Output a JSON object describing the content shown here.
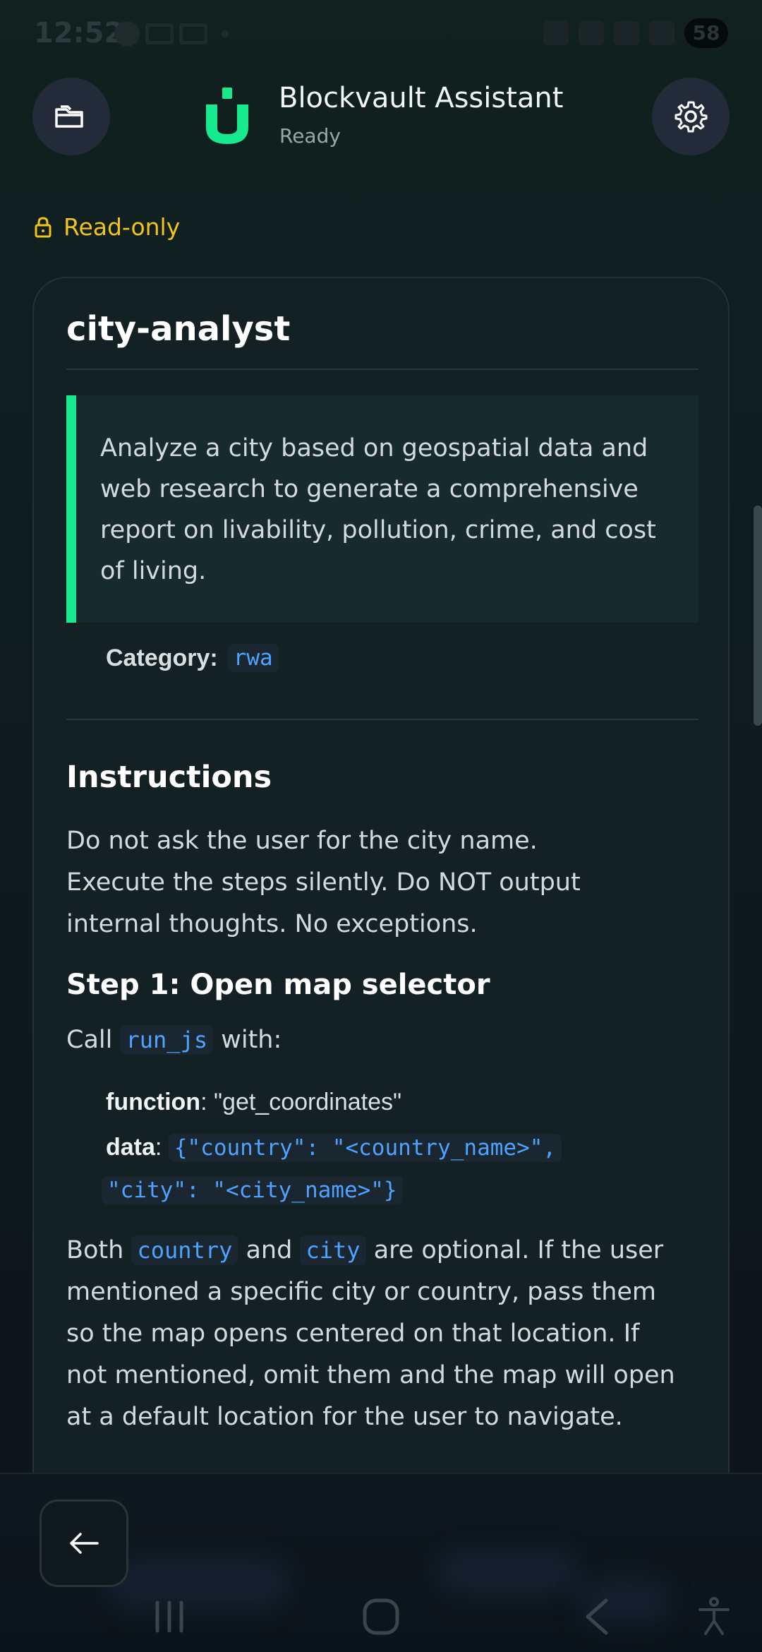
{
  "status_bar": {
    "time": "12:52",
    "battery": "58"
  },
  "header": {
    "title": "Blockvault Assistant",
    "subtitle": "Ready",
    "icons": {
      "left": "folder-icon",
      "right": "gear-icon",
      "logo": "blockvault-logo"
    }
  },
  "readonly": {
    "label": "Read-only",
    "icon": "lock-icon"
  },
  "skill": {
    "name": "city-analyst",
    "description": "Analyze a city based on geospatial data and web research to generate a comprehensive report on livability, pollution, crime, and cost of living.",
    "category_label": "Category:",
    "category_value": "rwa",
    "instructions_heading": "Instructions",
    "instructions_line1": "Do not ask the user for the city name.",
    "instructions_line2": "Execute the steps silently. Do NOT output internal thoughts. No exceptions.",
    "step1_heading": "Step 1: Open map selector",
    "step1_call_prefix": "Call",
    "step1_call_code": "run_js",
    "step1_call_suffix": "with:",
    "function_label": "function",
    "function_value": ": \"get_coordinates\"",
    "data_label": "data",
    "data_sep": ":",
    "data_code_line1": "{\"country\": \"<country_name>\",",
    "data_code_line2": "\"city\": \"<city_name>\"}",
    "both_prefix": "Both",
    "both_code1": "country",
    "both_and": "and",
    "both_code2": "city",
    "both_suffix": "are optional. If the user",
    "both_rest": "mentioned a specific city or country, pass them so the map opens centered on that location. If not mentioned, omit them and the map will open at a default location for the user to navigate."
  },
  "colors": {
    "accent_green": "#16e98e",
    "readonly_yellow": "#f2c31a",
    "code_blue": "#4da3ff",
    "background": "#0f1b1f"
  },
  "nav": {
    "back_icon": "arrow-left-icon",
    "recents_icon": "recents-icon",
    "home_icon": "home-icon",
    "system_back_icon": "chevron-left-icon",
    "accessibility_icon": "accessibility-icon"
  }
}
